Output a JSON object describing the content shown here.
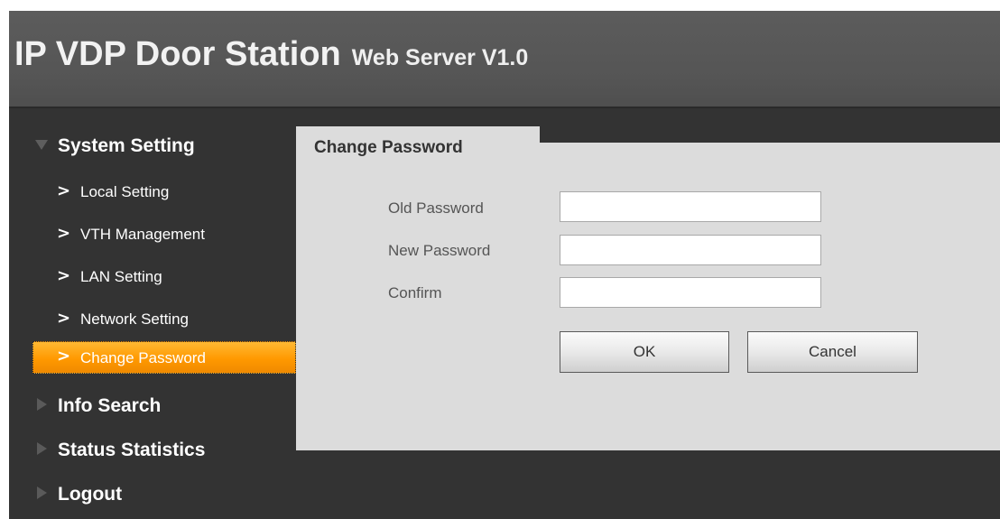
{
  "header": {
    "title": "IP VDP Door Station",
    "subtitle": "Web Server V1.0"
  },
  "sidebar": {
    "system_setting": {
      "label": "System Setting",
      "items": [
        {
          "label": "Local Setting"
        },
        {
          "label": "VTH Management"
        },
        {
          "label": "LAN Setting"
        },
        {
          "label": "Network Setting"
        },
        {
          "label": "Change Password"
        }
      ]
    },
    "info_search": {
      "label": "Info Search"
    },
    "status_statistics": {
      "label": "Status Statistics"
    },
    "logout": {
      "label": "Logout"
    }
  },
  "content": {
    "tab_title": "Change Password",
    "fields": {
      "old_password": {
        "label": "Old Password",
        "value": ""
      },
      "new_password": {
        "label": "New Password",
        "value": ""
      },
      "confirm": {
        "label": "Confirm",
        "value": ""
      }
    },
    "ok_label": "OK",
    "cancel_label": "Cancel"
  },
  "colors": {
    "header_bg": "#555555",
    "body_bg": "#333333",
    "panel_bg": "#dcdcdc",
    "active_item": "#ff9900"
  },
  "icons": {
    "expanded": "triangle-down-icon",
    "collapsed": "triangle-right-icon",
    "item": "chevron-right-icon"
  }
}
